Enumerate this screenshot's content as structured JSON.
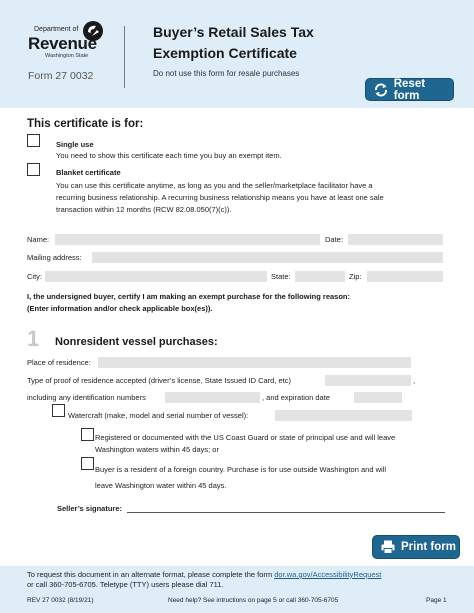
{
  "header": {
    "logo": {
      "dept_of": "Department of",
      "name": "Revenue",
      "state": "Washington State"
    },
    "form_number": "Form 27 0032",
    "title_line1": "Buyer’s Retail Sales Tax",
    "title_line2": "Exemption Certificate",
    "subtitle": "Do not use this form for resale purchases",
    "reset_label": "Reset form"
  },
  "certificate": {
    "heading": "This certificate is for:",
    "single": {
      "label": "Single use",
      "text": "You need to show this certificate each time you buy an exempt item."
    },
    "blanket": {
      "label": "Blanket certificate",
      "line1": "You can use this certificate anytime, as long as you and the seller/marketplace facilitator have a",
      "line2": "recurring business relationship. A recurring business relationship means you have at least one sale",
      "line3": "transaction within 12 months (RCW 82.08.050(7)(c))."
    }
  },
  "fields": {
    "name": "Name:",
    "date": "Date:",
    "mailing": "Mailing address:",
    "city": "City:",
    "state": "State:",
    "zip": "Zip:"
  },
  "certify": {
    "line1": "I, the undersigned buyer, certify I am making an exempt purchase for the following reason:",
    "line2": "(Enter information and/or check applicable box(es))."
  },
  "section1": {
    "number": "1",
    "title": "Nonresident vessel purchases:",
    "residence": "Place of residence:",
    "proof": "Type of proof of residence accepted (driver’s license, State Issued ID Card, etc)",
    "comma": ",",
    "including": "including any identification numbers",
    "expiration": ", and expiration date",
    "watercraft": "Watercraft (make, model and serial number of vessel):",
    "registered_line1": "Registered or documented with the US Coast Guard or state of principal use and will leave",
    "registered_line2": "Washington waters within 45 days; or",
    "buyer_line1": "Buyer is a resident of a foreign country. Purchase is for use outside Washington and will",
    "buyer_line2": "leave Washington water within 45 days.",
    "signature": "Seller’s signature:"
  },
  "footer": {
    "print_label": "Print form",
    "request_line1": "To request this document in an alternate format, please complete the form",
    "link": "dor.wa.gov/AccessibilityRequest",
    "request_line2": "or call 360-705-6705. Teletype (TTY) users please dial 711.",
    "rev": "REV 27 0032  (8/19/21)",
    "help": "Need help? See intructions on page 5 or call 360-705-6705",
    "page": "Page 1"
  }
}
